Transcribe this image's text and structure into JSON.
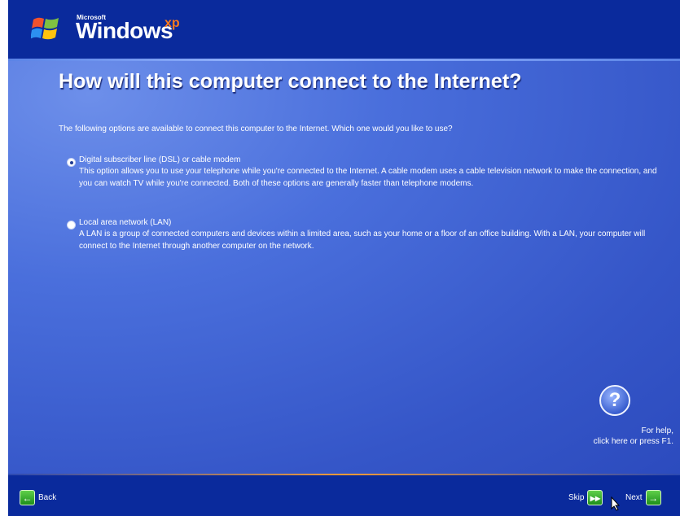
{
  "header": {
    "brand_company": "Microsoft",
    "brand_name": "Windows",
    "brand_suffix": "xp",
    "logo_icon": "windows-flag-icon"
  },
  "main": {
    "title": "How will this computer connect to the Internet?",
    "intro": "The following options are available to connect this computer to the Internet. Which one would you like to use?",
    "options": [
      {
        "label": "Digital subscriber line (DSL) or cable modem",
        "description": "This option allows you to use your telephone while you're connected to the Internet. A cable modem uses a cable television network to make the connection, and you can watch TV while you're connected. Both of these options are generally faster than telephone modems.",
        "selected": true
      },
      {
        "label": "Local area network (LAN)",
        "description": "A LAN is a group of connected computers and devices within a limited area, such as your home or a floor of an office building. With a LAN, your computer will connect to the Internet through another computer on the network.",
        "selected": false
      }
    ],
    "help": {
      "icon": "help-question-icon",
      "glyph": "?",
      "line1": "For help,",
      "line2": "click here or press F1."
    }
  },
  "footer": {
    "back_label": "Back",
    "skip_label": "Skip",
    "next_label": "Next"
  },
  "colors": {
    "header_bg": "#0a2a9c",
    "main_bg": "#3556c8",
    "accent_orange": "#f29a36",
    "button_green": "#1e8f1b"
  }
}
